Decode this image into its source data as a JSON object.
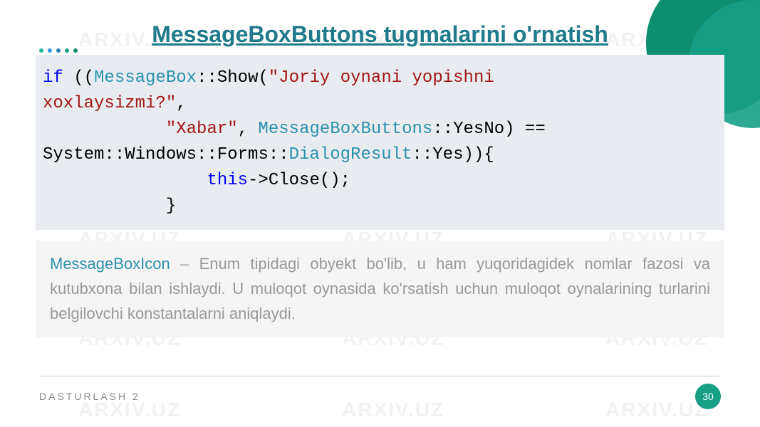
{
  "title": "MessageBoxButtons tugmalarini o'rnatish",
  "watermark_text": "ARXIV.UZ",
  "code": {
    "line1_if": "if",
    "line1_open": " ((",
    "line1_type1": "MessageBox",
    "line1_method": "::Show(",
    "line1_str1": "\"Joriy oynani yopishni",
    "line2_str": "xoxlaysizmi?\"",
    "line2_comma": ",",
    "line3_indent": "            ",
    "line3_str": "\"Xabar\"",
    "line3_comma": ", ",
    "line3_type": "MessageBoxButtons",
    "line3_rest": "::YesNo) ==",
    "line4_part1": "System::Windows::Forms::",
    "line4_type": "DialogResult",
    "line4_rest": "::Yes)){",
    "line5_indent": "                ",
    "line5_this": "this",
    "line5_rest": "->Close();",
    "line6_indent": "            ",
    "line6_brace": "}"
  },
  "description": {
    "type_name": "MessageBoxIcon",
    "dash": " – ",
    "text": "Enum tipidagi obyekt bo'lib, u ham yuqoridagidek nomlar fazosi va kutubxona bilan ishlaydi. U muloqot oynasida ko'rsatish uchun muloqot oynalarining turlarini belgilovchi konstantalarni aniqlaydi."
  },
  "footer": {
    "course_name": "DASTURLASH 2",
    "page": "30"
  },
  "chart_data": null
}
